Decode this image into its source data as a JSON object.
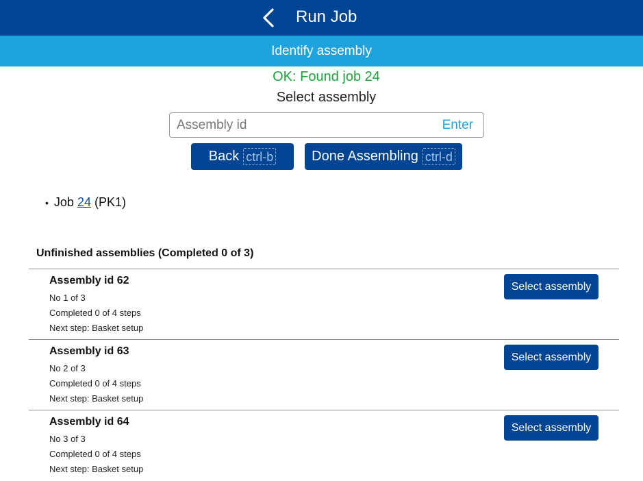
{
  "header": {
    "title": "Run Job",
    "back_icon": "chevron-left-icon"
  },
  "subheader": {
    "title": "Identify assembly"
  },
  "status": {
    "message": "OK: Found job 24",
    "color": "#1fa33c"
  },
  "prompt": {
    "heading": "Select assembly"
  },
  "search": {
    "placeholder": "Assembly id",
    "value": "",
    "enter_label": "Enter"
  },
  "actions": {
    "back_label": "Back",
    "back_shortcut": "ctrl-b",
    "done_label": "Done Assembling",
    "done_shortcut": "ctrl-d"
  },
  "job": {
    "prefix": "Job",
    "id": "24",
    "suffix": "(PK1)"
  },
  "section": {
    "title": "Unfinished assemblies (Completed 0 of 3)"
  },
  "assemblies": [
    {
      "title": "Assembly id 62",
      "position": "No 1 of 3",
      "progress": "Completed 0 of 4 steps",
      "next_step": "Next step: Basket setup",
      "button": "Select assembly"
    },
    {
      "title": "Assembly id 63",
      "position": "No 2 of 3",
      "progress": "Completed 0 of 4 steps",
      "next_step": "Next step: Basket setup",
      "button": "Select assembly"
    },
    {
      "title": "Assembly id 64",
      "position": "No 3 of 3",
      "progress": "Completed 0 of 4 steps",
      "next_step": "Next step: Basket setup",
      "button": "Select assembly"
    }
  ],
  "colors": {
    "primary": "#004494",
    "accent": "#1fa3df",
    "success": "#1fa33c"
  }
}
